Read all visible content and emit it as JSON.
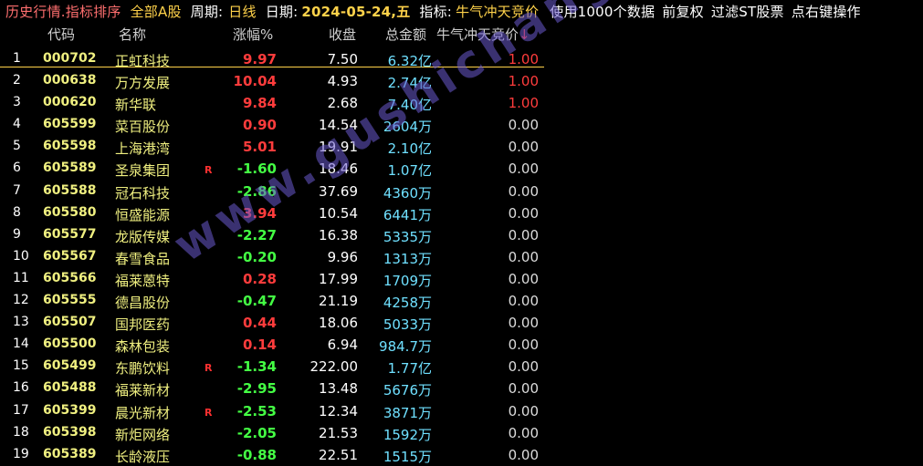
{
  "topbar": {
    "history": "历史行情.指标排序",
    "market": "全部A股",
    "period_label": "周期:",
    "period": "日线",
    "date_label": "日期:",
    "date": "2024-05-24,五",
    "indicator_label": "指标:",
    "indicator": "牛气冲天竞价",
    "data_note": "使用1000个数据",
    "adjust": "前复权",
    "filter": "过滤ST股票",
    "right_click": "点右键操作"
  },
  "table": {
    "headers": {
      "code": "代码",
      "name": "名称",
      "change": "涨幅%",
      "close": "收盘",
      "amount": "总金额",
      "indicator": "牛气冲天竞价",
      "sort_arrow": "↓"
    },
    "rows": [
      {
        "idx": "1",
        "code": "000702",
        "name": "正虹科技",
        "flag": "",
        "chg": "9.97",
        "dir": "up",
        "close": "7.50",
        "amt": "6.32亿",
        "ind": "1.00",
        "ind_dir": "up"
      },
      {
        "idx": "2",
        "code": "000638",
        "name": "万方发展",
        "flag": "",
        "chg": "10.04",
        "dir": "up",
        "close": "4.93",
        "amt": "2.74亿",
        "ind": "1.00",
        "ind_dir": "up"
      },
      {
        "idx": "3",
        "code": "000620",
        "name": "新华联",
        "flag": "",
        "chg": "9.84",
        "dir": "up",
        "close": "2.68",
        "amt": "7.40亿",
        "ind": "1.00",
        "ind_dir": "up"
      },
      {
        "idx": "4",
        "code": "605599",
        "name": "菜百股份",
        "flag": "",
        "chg": "0.90",
        "dir": "up",
        "close": "14.54",
        "amt": "2604万",
        "ind": "0.00",
        "ind_dir": "flat"
      },
      {
        "idx": "5",
        "code": "605598",
        "name": "上海港湾",
        "flag": "",
        "chg": "5.01",
        "dir": "up",
        "close": "19.91",
        "amt": "2.10亿",
        "ind": "0.00",
        "ind_dir": "flat"
      },
      {
        "idx": "6",
        "code": "605589",
        "name": "圣泉集团",
        "flag": "R",
        "chg": "-1.60",
        "dir": "down",
        "close": "18.46",
        "amt": "1.07亿",
        "ind": "0.00",
        "ind_dir": "flat"
      },
      {
        "idx": "7",
        "code": "605588",
        "name": "冠石科技",
        "flag": "",
        "chg": "-2.86",
        "dir": "down",
        "close": "37.69",
        "amt": "4360万",
        "ind": "0.00",
        "ind_dir": "flat"
      },
      {
        "idx": "8",
        "code": "605580",
        "name": "恒盛能源",
        "flag": "",
        "chg": "3.94",
        "dir": "up",
        "close": "10.54",
        "amt": "6441万",
        "ind": "0.00",
        "ind_dir": "flat"
      },
      {
        "idx": "9",
        "code": "605577",
        "name": "龙版传媒",
        "flag": "",
        "chg": "-2.27",
        "dir": "down",
        "close": "16.38",
        "amt": "5335万",
        "ind": "0.00",
        "ind_dir": "flat"
      },
      {
        "idx": "10",
        "code": "605567",
        "name": "春雪食品",
        "flag": "",
        "chg": "-0.20",
        "dir": "down",
        "close": "9.96",
        "amt": "1313万",
        "ind": "0.00",
        "ind_dir": "flat"
      },
      {
        "idx": "11",
        "code": "605566",
        "name": "福莱蒽特",
        "flag": "",
        "chg": "0.28",
        "dir": "up",
        "close": "17.99",
        "amt": "1709万",
        "ind": "0.00",
        "ind_dir": "flat"
      },
      {
        "idx": "12",
        "code": "605555",
        "name": "德昌股份",
        "flag": "",
        "chg": "-0.47",
        "dir": "down",
        "close": "21.19",
        "amt": "4258万",
        "ind": "0.00",
        "ind_dir": "flat"
      },
      {
        "idx": "13",
        "code": "605507",
        "name": "国邦医药",
        "flag": "",
        "chg": "0.44",
        "dir": "up",
        "close": "18.06",
        "amt": "5033万",
        "ind": "0.00",
        "ind_dir": "flat"
      },
      {
        "idx": "14",
        "code": "605500",
        "name": "森林包装",
        "flag": "",
        "chg": "0.14",
        "dir": "up",
        "close": "6.94",
        "amt": "984.7万",
        "ind": "0.00",
        "ind_dir": "flat"
      },
      {
        "idx": "15",
        "code": "605499",
        "name": "东鹏饮料",
        "flag": "R",
        "chg": "-1.34",
        "dir": "down",
        "close": "222.00",
        "amt": "1.77亿",
        "ind": "0.00",
        "ind_dir": "flat"
      },
      {
        "idx": "16",
        "code": "605488",
        "name": "福莱新材",
        "flag": "",
        "chg": "-2.95",
        "dir": "down",
        "close": "13.48",
        "amt": "5676万",
        "ind": "0.00",
        "ind_dir": "flat"
      },
      {
        "idx": "17",
        "code": "605399",
        "name": "晨光新材",
        "flag": "R",
        "chg": "-2.53",
        "dir": "down",
        "close": "12.34",
        "amt": "3871万",
        "ind": "0.00",
        "ind_dir": "flat"
      },
      {
        "idx": "18",
        "code": "605398",
        "name": "新炬网络",
        "flag": "",
        "chg": "-2.05",
        "dir": "down",
        "close": "21.53",
        "amt": "1592万",
        "ind": "0.00",
        "ind_dir": "flat"
      },
      {
        "idx": "19",
        "code": "605389",
        "name": "长龄液压",
        "flag": "",
        "chg": "-0.88",
        "dir": "down",
        "close": "22.51",
        "amt": "1515万",
        "ind": "0.00",
        "ind_dir": "flat"
      }
    ]
  },
  "watermark": "www.gushichanghong.com",
  "colors": {
    "background": "#000000",
    "up": "#ff3c3c",
    "down": "#44ff44",
    "code_name": "#f0f080",
    "amount": "#6fe0ff",
    "accent": "#ffd24a"
  }
}
